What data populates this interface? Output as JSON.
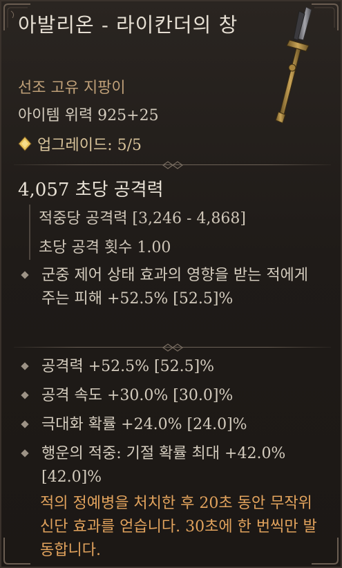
{
  "item": {
    "name": "아발리온 - 라이칸더의 창",
    "type": "선조 고유 지팡이",
    "power": "아이템 위력 925+25",
    "upgrade": "업그레이드: 5/5"
  },
  "weapon": {
    "dps": "4,057 초당 공격력",
    "damage_per_hit": "적중당 공격력 [3,246 - 4,868]",
    "attacks_per_second": "초당 공격 횟수 1.00"
  },
  "implicit": [
    "군중 제어 상태 효과의 영향을 받는 적에게 주는 피해 +52.5% [52.5]%"
  ],
  "affixes": [
    "공격력 +52.5% [52.5]%",
    "공격 속도 +30.0% [30.0]%",
    "극대화 확률 +24.0% [24.0]%",
    "행운의 적중: 기절 확률 최대 +42.0% [42.0]%"
  ],
  "unique_effect": "적의 정예병을 처치한 후 20초 동안 무작위 신단 효과를 얻습니다. 30초에 한 번씩만 발동합니다.",
  "colors": {
    "unique_text": "#e2a35d",
    "subtitle": "#bfa078",
    "upgrade": "#d9c49b",
    "background": "#221e1a"
  },
  "icons": [
    "upgrade-diamond-icon",
    "bullet-diamond-icon",
    "spear-item-icon"
  ]
}
